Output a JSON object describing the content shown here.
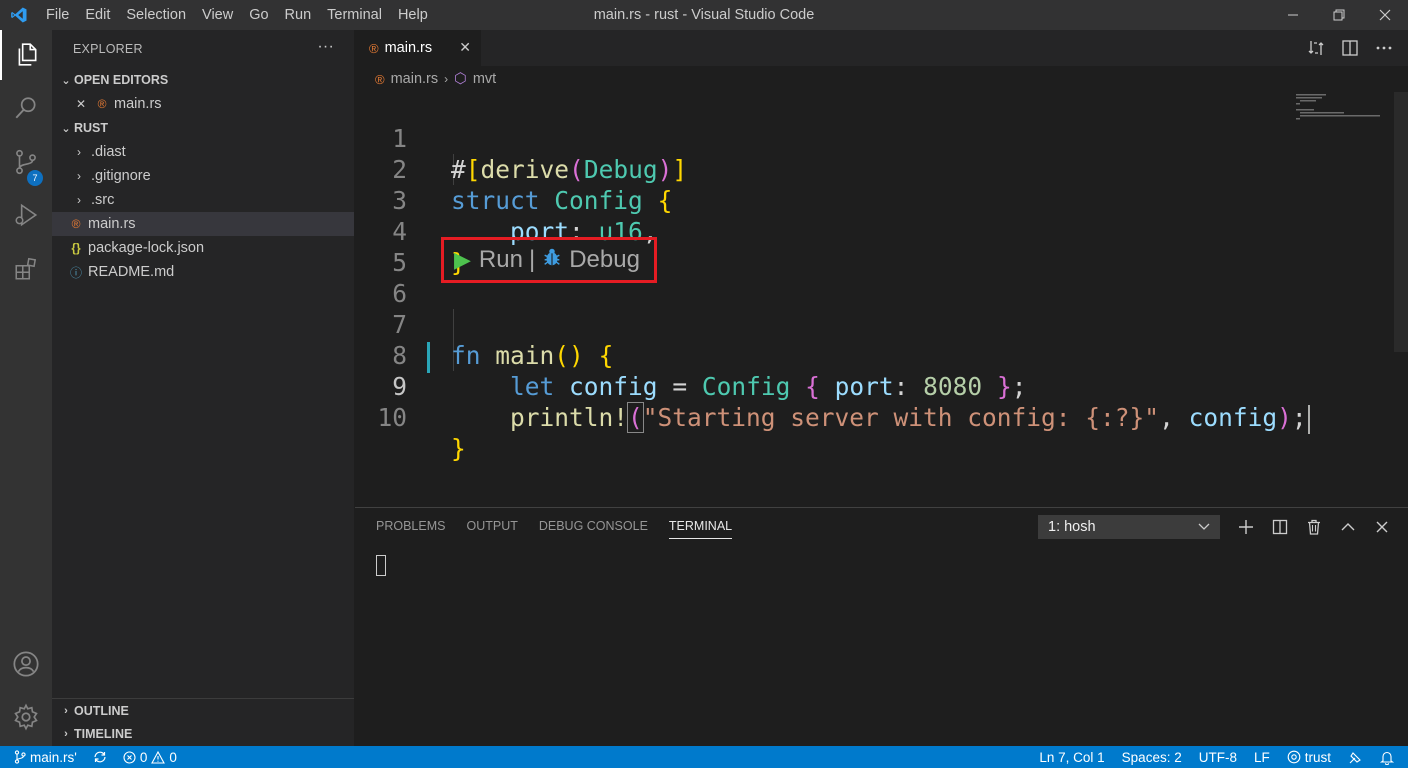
{
  "window": {
    "title": "main.rs - rust - Visual Studio Code",
    "menu": [
      "File",
      "Edit",
      "Selection",
      "View",
      "Go",
      "Run",
      "Terminal",
      "Help"
    ]
  },
  "activity_bar": {
    "items": [
      "explorer-icon",
      "search-icon",
      "source-control-icon",
      "run-debug-icon",
      "extensions-icon"
    ],
    "source_control_badge": "7",
    "bottom": [
      "account-icon",
      "manage-gear-icon"
    ]
  },
  "sidebar": {
    "header": "EXPLORER",
    "more": "···",
    "open_editors": {
      "title": "OPEN EDITORS",
      "items": [
        {
          "close": "✕",
          "label": "main.rs"
        }
      ]
    },
    "folder": {
      "title": "RUST",
      "items": [
        {
          "label": ".diast",
          "type": "folder"
        },
        {
          "label": ".gitignore",
          "type": "folder"
        },
        {
          "label": ".src",
          "type": "folder"
        },
        {
          "label": "main.rs",
          "type": "rust"
        },
        {
          "label": "package-lock.json",
          "type": "json"
        },
        {
          "label": "README.md",
          "type": "info"
        }
      ]
    },
    "outline": "OUTLINE",
    "timeline": "TIMELINE"
  },
  "tab": {
    "label": "main.rs",
    "close": "✕"
  },
  "breadcrumb": {
    "file": "main.rs",
    "symbol": "mvt"
  },
  "editor": {
    "line_numbers": [
      "1",
      "2",
      "3",
      "4",
      "5",
      "6",
      "7",
      "8",
      "9",
      "10"
    ],
    "codelens": {
      "run": "Run",
      "separator": "|",
      "debug": "Debug"
    }
  },
  "panel": {
    "tabs": [
      "PROBLEMS",
      "OUTPUT",
      "DEBUG CONSOLE",
      "TERMINAL"
    ],
    "active_tab": "TERMINAL",
    "terminal_select": "1: hosh"
  },
  "status_bar": {
    "branch": "main.rs'",
    "errors": "0",
    "warnings": "0",
    "position": "Ln 7, Col 1",
    "spaces": "Spaces: 2",
    "encoding": "UTF-8",
    "eol": "LF",
    "language": "trust"
  },
  "colors": {
    "accent": "#007acc",
    "highlight_box": "#e51c23"
  }
}
